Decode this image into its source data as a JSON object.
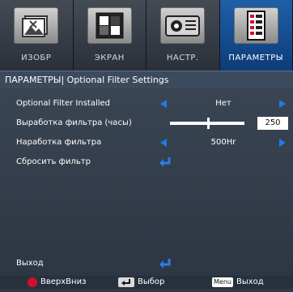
{
  "tabs": [
    {
      "label": "ИЗОБР",
      "icon": "image-icon",
      "active": false
    },
    {
      "label": "ЭКРАН",
      "icon": "screen-icon",
      "active": false
    },
    {
      "label": "НАСТР.",
      "icon": "projector-settings-icon",
      "active": false
    },
    {
      "label": "ПАРАМЕТРЫ",
      "icon": "options-icon",
      "active": true
    }
  ],
  "breadcrumb": "ПАРАМЕТРЫ| Optional Filter Settings",
  "rows": {
    "filter_installed": {
      "label": "Optional Filter Installed",
      "value": "Нет"
    },
    "filter_hours": {
      "label": "Выработка фильтра (часы)",
      "value": "250",
      "level_fraction": 0.5
    },
    "filter_reminder": {
      "label": "Наработка фильтра",
      "value": "500Hr"
    },
    "filter_reset": {
      "label": "Сбросить фильтр"
    },
    "exit": {
      "label": "Выход"
    }
  },
  "footer": {
    "updown_label": "ВверхВниз",
    "select_label": "Выбор",
    "menu_key": "Menu",
    "exit_label": "Выход"
  },
  "colors": {
    "accent_arrow": "#1f7ce8",
    "active_tab": "#1f5fa8",
    "enter_icon": "#2b7de9"
  }
}
